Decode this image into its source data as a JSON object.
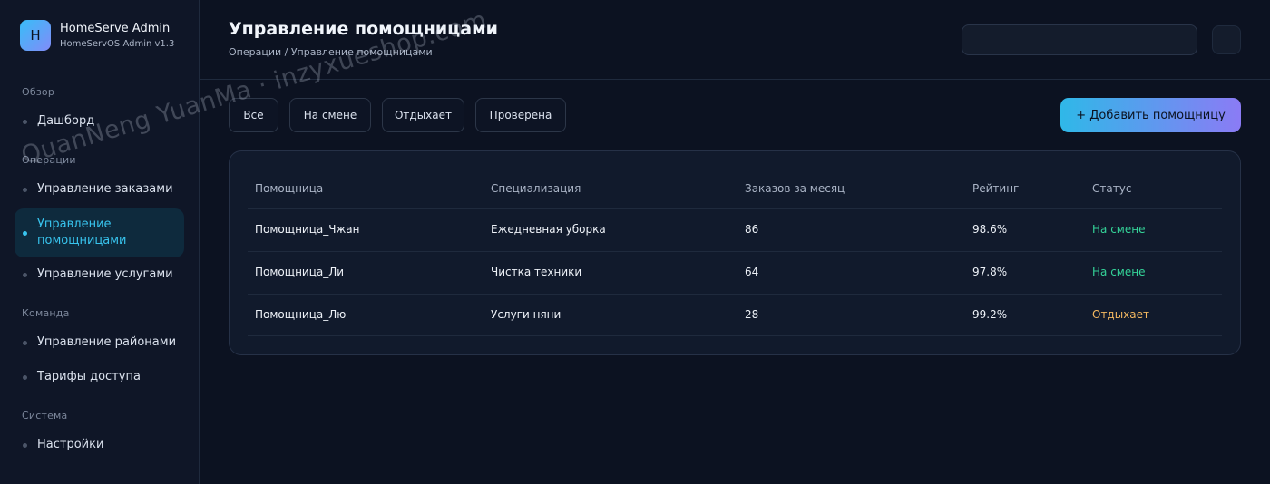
{
  "brand": {
    "logo_letter": "H",
    "title": "HomeServe Admin",
    "subtitle": "HomeServOS Admin v1.3"
  },
  "sidebar": {
    "sections": [
      {
        "label": "Обзор",
        "items": [
          {
            "label": "Дашборд",
            "active": false
          }
        ]
      },
      {
        "label": "Операции",
        "items": [
          {
            "label": "Управление заказами",
            "active": false
          },
          {
            "label": "Управление помощницами",
            "active": true
          },
          {
            "label": "Управление услугами",
            "active": false
          }
        ]
      },
      {
        "label": "Команда",
        "items": [
          {
            "label": "Управление районами",
            "active": false
          },
          {
            "label": "Тарифы доступа",
            "active": false
          }
        ]
      },
      {
        "label": "Система",
        "items": [
          {
            "label": "Настройки",
            "active": false
          }
        ]
      }
    ]
  },
  "header": {
    "title": "Управление помощницами",
    "breadcrumb": "Операции / Управление помощницами",
    "search_value": ""
  },
  "filters": [
    "Все",
    "На смене",
    "Отдыхает",
    "Проверена"
  ],
  "add_button_label": "+ Добавить помощницу",
  "table": {
    "columns": [
      "Помощница",
      "Специализация",
      "Заказов за месяц",
      "Рейтинг",
      "Статус"
    ],
    "rows": [
      {
        "name": "Помощница_Чжан",
        "spec": "Ежедневная уборка",
        "orders": "86",
        "rating": "98.6%",
        "status": "На смене",
        "status_kind": "on"
      },
      {
        "name": "Помощница_Ли",
        "spec": "Чистка техники",
        "orders": "64",
        "rating": "97.8%",
        "status": "На смене",
        "status_kind": "on"
      },
      {
        "name": "Помощница_Лю",
        "spec": "Услуги няни",
        "orders": "28",
        "rating": "99.2%",
        "status": "Отдыхает",
        "status_kind": "off"
      }
    ]
  },
  "watermark": "QuanNeng YuanMa · inzyxueshop.com",
  "colors": {
    "accent": "#38c4ee",
    "status_on": "#34d399",
    "status_off": "#f4b860",
    "background": "#0c1221"
  }
}
